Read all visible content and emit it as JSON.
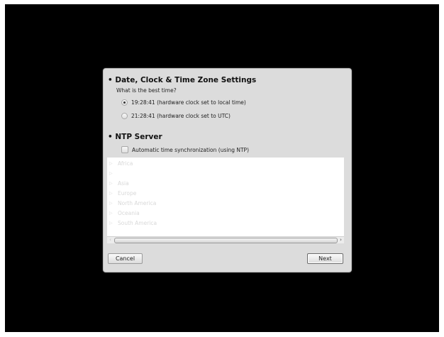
{
  "datetime_section": {
    "bullet": "•",
    "title": "Date, Clock & Time Zone Settings",
    "question": "What is the best time?",
    "options": [
      {
        "label": "19:28:41 (hardware clock set to local time)",
        "selected": true
      },
      {
        "label": "21:28:41 (hardware clock set to UTC)",
        "selected": false
      }
    ]
  },
  "ntp_section": {
    "bullet": "•",
    "title": "NTP Server",
    "checkbox_label": "Automatic time synchronization (using NTP)",
    "checked": false
  },
  "timezone_tree": {
    "expander_icon": "triangle-right-icon",
    "items": [
      "Africa",
      "",
      "Asia",
      "Europe",
      "North America",
      "Oceania",
      "South America"
    ]
  },
  "scrollbar": {
    "left_arrow": "‹",
    "right_arrow": "›"
  },
  "buttons": {
    "cancel": "Cancel",
    "next": "Next"
  }
}
